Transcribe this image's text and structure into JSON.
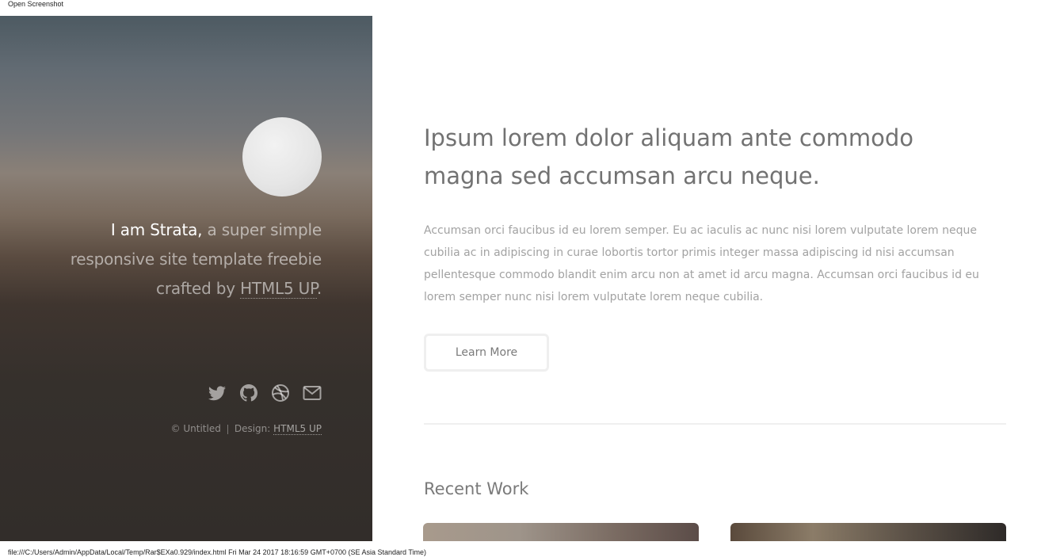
{
  "window": {
    "title": "Open Screenshot",
    "status_path": "file:///C:/Users/Admin/AppData/Local/Temp/Rar$EXa0.929/index.html Fri Mar 24 2017 18:16:59 GMT+0700 (SE Asia Standard Time)"
  },
  "header": {
    "intro_strong": "I am Strata,",
    "intro_rest": " a super simple responsive site template freebie crafted by ",
    "intro_link": "HTML5 UP",
    "intro_end": ".",
    "social_icons": [
      "twitter-icon",
      "github-icon",
      "dribbble-icon",
      "envelope-icon"
    ],
    "copyright": "© Untitled",
    "design_label": "Design: ",
    "design_link": "HTML5 UP"
  },
  "main": {
    "title_line1": "Ipsum lorem dolor aliquam ante commodo",
    "title_line2": "magna sed accumsan arcu neque.",
    "paragraph": "Accumsan orci faucibus id eu lorem semper. Eu ac iaculis ac nunc nisi lorem vulputate lorem neque cubilia ac in adipiscing in curae lobortis tortor primis integer massa adipiscing id nisi accumsan pellentesque commodo blandit enim arcu non at amet id arcu magna. Accumsan orci faucibus id eu lorem semper nunc nisi lorem vulputate lorem neque cubilia.",
    "button_label": "Learn More",
    "recent_title": "Recent Work"
  },
  "colors": {
    "text_main": "#727272",
    "text_muted": "#a2a2a2",
    "border": "#efefef"
  }
}
